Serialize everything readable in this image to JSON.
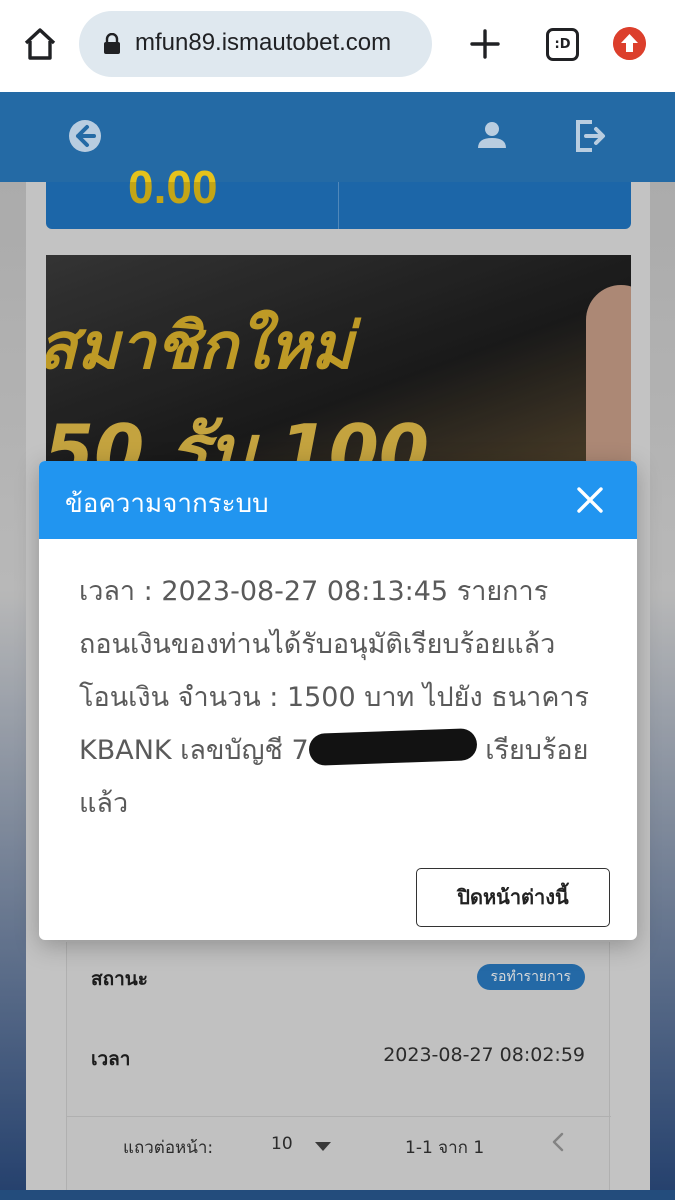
{
  "browser": {
    "url": "mfun89.ismautobet.com",
    "tab_switcher_label": ":D",
    "icons": [
      "home-icon",
      "lock-icon",
      "new-tab-icon",
      "tab-switcher-icon",
      "update-icon"
    ]
  },
  "app_header": {
    "icons": [
      "back-arrow-icon",
      "user-icon",
      "logout-icon"
    ]
  },
  "background": {
    "balance_amount": "0.00",
    "banner_line1": "สมาชิกใหม่",
    "banner_line2": "50 รับ 100",
    "status_label": "สถานะ",
    "status_badge": "รอทำรายการ",
    "time_label": "เวลา",
    "time_value": "2023-08-27 08:02:59",
    "rows_per_page_label": "แถวต่อหน้า:",
    "rows_per_page_value": "10",
    "page_range": "1-1 จาก 1"
  },
  "modal": {
    "title": "ข้อความจากระบบ",
    "message_before": "เวลา : 2023-08-27 08:13:45 รายการถอนเงินของท่านได้รับอนุมัติเรียบร้อยแล้ว โอนเงิน จำนวน : 1500 บาท ไปยัง ธนาคาร KBANK เลขบัญชี 7",
    "message_after": " เรียบร้อยแล้ว",
    "close_button": "ปิดหน้าต่างนี้"
  },
  "colors": {
    "header_blue": "#246aa5",
    "modal_header_blue": "#2195f0",
    "badge_blue": "#2b7cc4",
    "balance_gold": "#e5c21b"
  }
}
